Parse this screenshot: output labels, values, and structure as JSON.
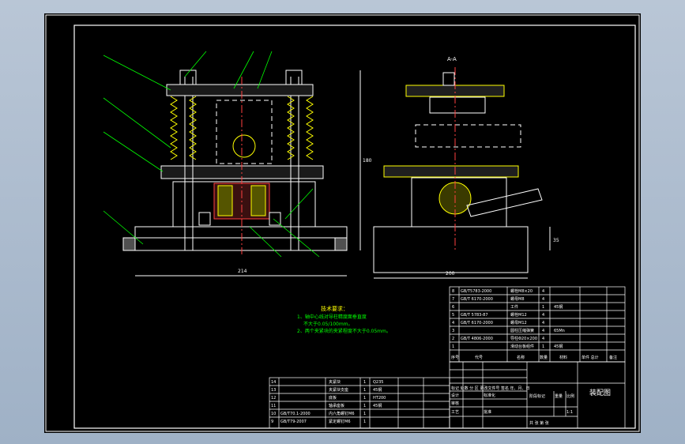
{
  "drawing": {
    "title_block_name": "装配图",
    "section_label": "A-A",
    "scale": "1:1",
    "tech_req": {
      "title": "技术要求：",
      "lines": [
        "1、轴中心线对导柱精度面垂直度",
        "不大于0.05/100mm。",
        "2、两个夹紧块的夹紧程度不大于0.05mm。"
      ]
    },
    "dims": {
      "width_front": "214",
      "height_front": "180",
      "width_side": "200",
      "small_side": "35"
    },
    "bom_upper": [
      {
        "no": "8",
        "code": "GB/T5783-2000",
        "name": "螺栓M8×20",
        "qty": "4",
        "mat": ""
      },
      {
        "no": "7",
        "code": "GB/T 6170-2000",
        "name": "螺母M8",
        "qty": "4",
        "mat": ""
      },
      {
        "no": "6",
        "code": "",
        "name": "工件",
        "qty": "1",
        "mat": "45钢"
      },
      {
        "no": "5",
        "code": "GB/T 5783-87",
        "name": "螺栓M12",
        "qty": "4",
        "mat": ""
      },
      {
        "no": "4",
        "code": "GB/T 6170-2000",
        "name": "螺母M12",
        "qty": "4",
        "mat": ""
      },
      {
        "no": "3",
        "code": "",
        "name": "圆柱压缩弹簧",
        "qty": "4",
        "mat": "65Mn"
      },
      {
        "no": "2",
        "code": "GB/T 4806-2000",
        "name": "导柱Φ20×200",
        "qty": "4",
        "mat": ""
      },
      {
        "no": "1",
        "code": "",
        "name": "滑动台板组件",
        "qty": "1",
        "mat": "45钢"
      },
      {
        "no": "",
        "code": "",
        "name": "支承板",
        "qty": "",
        "mat": "HT200"
      }
    ],
    "bom_header": {
      "no": "序号",
      "code": "代号",
      "name": "名称",
      "qty": "数量",
      "mat": "材料",
      "weight": "单件 总计",
      "note": "备注"
    },
    "bom_lower": [
      {
        "no": "14",
        "code": "",
        "name": "夹紧块",
        "qty": "1",
        "mat": "Q235"
      },
      {
        "no": "13",
        "code": "",
        "name": "夹紧块支座",
        "qty": "1",
        "mat": "45钢"
      },
      {
        "no": "12",
        "code": "",
        "name": "底板",
        "qty": "1",
        "mat": "HT200"
      },
      {
        "no": "11",
        "code": "",
        "name": "轴承座板",
        "qty": "1",
        "mat": "45钢"
      },
      {
        "no": "10",
        "code": "GB/T70.1-2000",
        "name": "内六角螺钉M6",
        "qty": "1",
        "mat": ""
      },
      {
        "no": "9",
        "code": "GB/T79-2007",
        "name": "紧定螺钉M6",
        "qty": "1",
        "mat": ""
      }
    ],
    "title_block": {
      "row1": "标记 处数 分 区 更改文件号 签名 年、月、日",
      "design": "设计",
      "standard": "标准化",
      "audit": "审核",
      "process": "工艺",
      "approve": "批准",
      "stage_label": "阶段标记",
      "weight_label": "重量",
      "scale_label": "比例",
      "sheets": "共 张 第 张"
    }
  },
  "colors": {
    "line": "#ffffff",
    "green": "#00ff00",
    "yellow": "#ffff00",
    "red": "#ff3030",
    "cyan": "#00ffff"
  }
}
